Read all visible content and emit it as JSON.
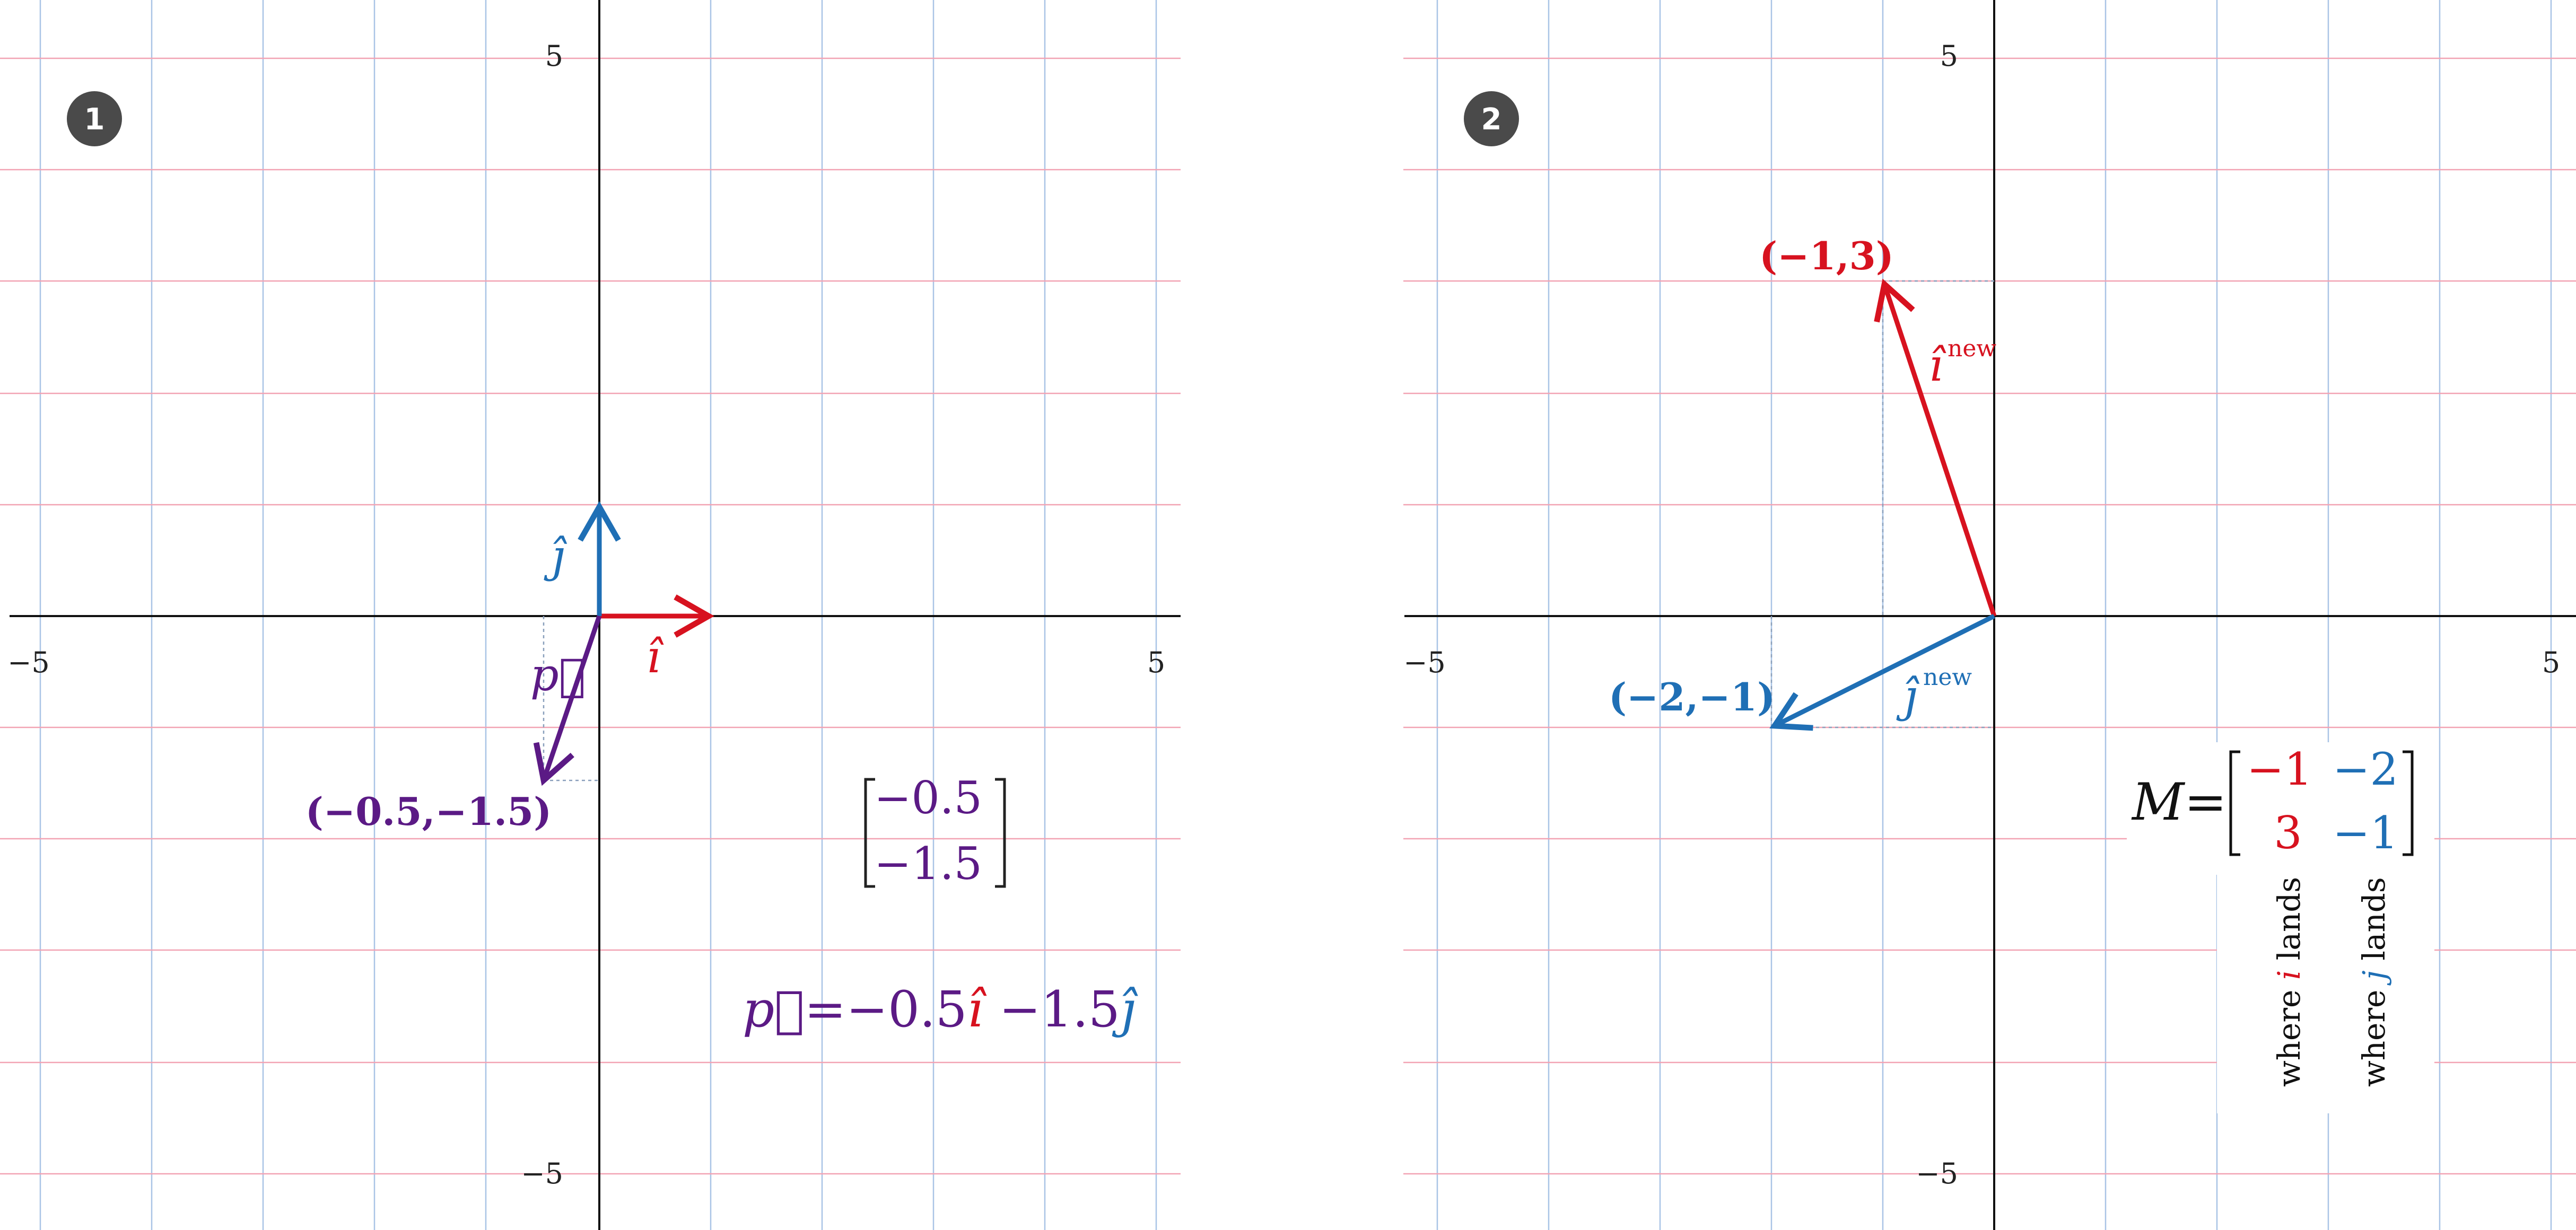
{
  "colors": {
    "grid_vertical": "#a9c4e6",
    "grid_horizontal": "#f2a3b3",
    "axis": "#111111",
    "i_hat": "#d7121f",
    "j_hat": "#1f6fb5",
    "p_vec": "#5b1a85",
    "badge": "#4a4a4a",
    "guide": "#8aa0bc"
  },
  "panel1": {
    "badge": "1",
    "tick_x_min": "−5",
    "tick_x_max": "5",
    "tick_y_min": "−5",
    "tick_y_max": "5",
    "i_label": "î",
    "j_label": "ĵ",
    "p_label": "p⃗",
    "p_coord": "(−0.5,−1.5)",
    "p_col_top": "−0.5",
    "p_col_bottom": "−1.5",
    "eq_p": "p⃗",
    "eq_eq": "=",
    "eq_coef1": "−0.5",
    "eq_i": "î",
    "eq_coef2": " −1.5",
    "eq_j": "ĵ"
  },
  "panel2": {
    "badge": "2",
    "tick_x_min": "−5",
    "tick_x_max": "5",
    "tick_y_min": "−5",
    "tick_y_max": "5",
    "i_new_coord": "(−1,3)",
    "j_new_coord": "(−2,−1)",
    "i_new_label": "î",
    "j_new_label": "ĵ",
    "new_sup": "new",
    "matrix_name": "M",
    "matrix_eq": "=",
    "m11": "−1",
    "m12": "−2",
    "m21": "3",
    "m22": "−1",
    "where_word": "where",
    "where_i_var": "i",
    "where_j_var": "j",
    "lands_word": "lands"
  },
  "vectors": {
    "p": [
      -0.5,
      -1.5
    ],
    "i_hat": [
      1,
      0
    ],
    "j_hat": [
      0,
      1
    ],
    "i_new": [
      -1,
      3
    ],
    "j_new": [
      -2,
      -1
    ]
  }
}
